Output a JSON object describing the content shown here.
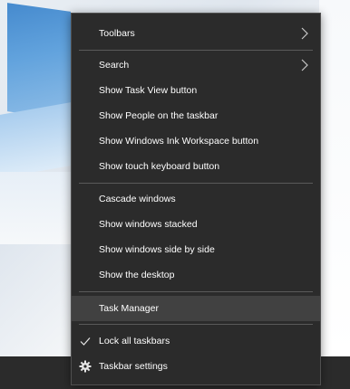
{
  "menu": {
    "toolbars": "Toolbars",
    "search": "Search",
    "task_view": "Show Task View button",
    "people": "Show People on the taskbar",
    "ink_workspace": "Show Windows Ink Workspace button",
    "touch_keyboard": "Show touch keyboard button",
    "cascade": "Cascade windows",
    "stacked": "Show windows stacked",
    "side_by_side": "Show windows side by side",
    "desktop": "Show the desktop",
    "task_manager": "Task Manager",
    "lock_taskbars": "Lock all taskbars",
    "taskbar_settings": "Taskbar settings"
  },
  "state": {
    "lock_taskbars_checked": true,
    "highlighted_item": "Task Manager"
  },
  "colors": {
    "menu_background": "#2b2b2b",
    "highlight": "#414141",
    "separator": "#5a5a5a",
    "text": "#ffffff"
  }
}
